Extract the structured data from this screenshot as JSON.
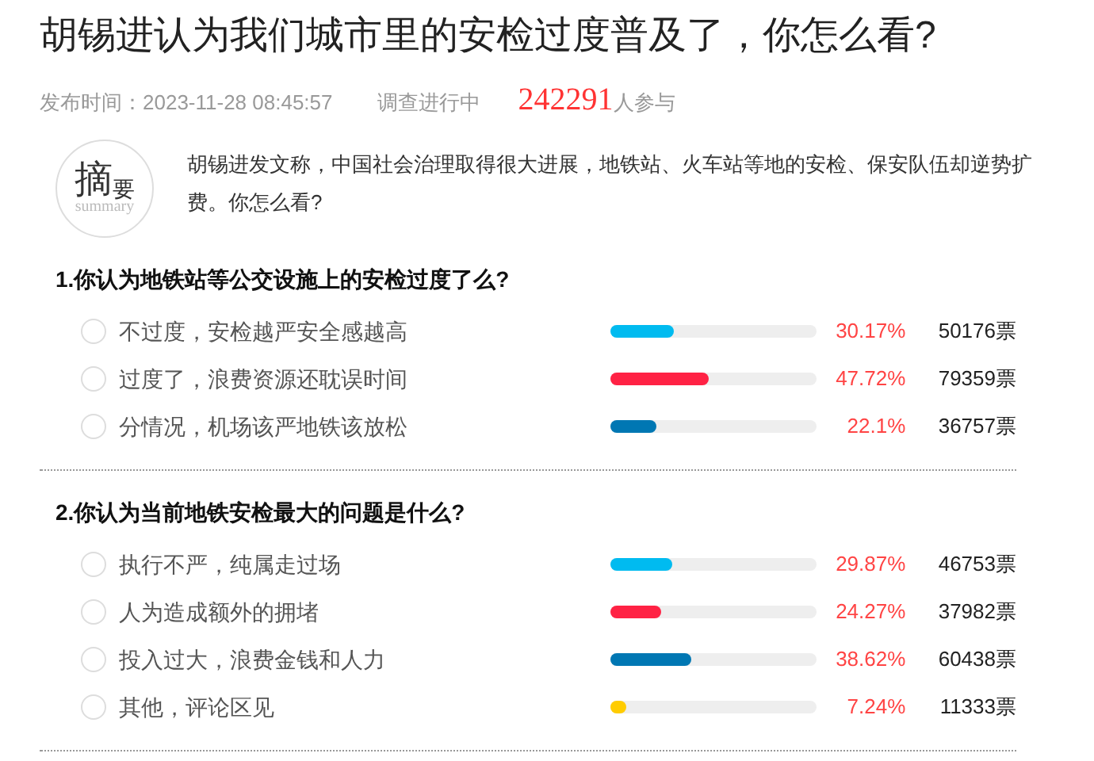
{
  "title": "胡锡进认为我们城市里的安检过度普及了，你怎么看?",
  "meta": {
    "published": "发布时间：2023-11-28 08:45:57",
    "status": "调查进行中",
    "participants": "242291",
    "participants_suffix": "人参与"
  },
  "summary": {
    "badge_main": "摘",
    "badge_sub": "要",
    "badge_word": "summary",
    "lines": [
      "胡锡进发文称，中国社会治理取得很大进展，地铁站、火车站等地的安检、保安队伍却逆势扩",
      "费。你怎么看?"
    ]
  },
  "questions": [
    {
      "title": "1.你认为地铁站等公交设施上的安检过度了么?",
      "options": [
        {
          "label": "不过度，安检越严安全感越高",
          "selected": false,
          "level": 0.3017,
          "color": "#00bbf0",
          "percent": "30.17%",
          "votes": "50176票"
        },
        {
          "label": "过度了，浪费资源还耽误时间",
          "selected": false,
          "level": 0.4772,
          "color": "#ff2244",
          "percent": "47.72%",
          "votes": "79359票"
        },
        {
          "label": "分情况，机场该严地铁该放松",
          "selected": false,
          "level": 0.221,
          "color": "#0077b3",
          "percent": "22.1%",
          "votes": "36757票"
        }
      ]
    },
    {
      "title": "2.你认为当前地铁安检最大的问题是什么?",
      "options": [
        {
          "label": "执行不严，纯属走过场",
          "selected": false,
          "level": 0.2987,
          "color": "#00bbf0",
          "percent": "29.87%",
          "votes": "46753票"
        },
        {
          "label": "人为造成额外的拥堵",
          "selected": false,
          "level": 0.2427,
          "color": "#ff2244",
          "percent": "24.27%",
          "votes": "37982票"
        },
        {
          "label": "投入过大，浪费金钱和人力",
          "selected": false,
          "level": 0.3862,
          "color": "#0077b3",
          "percent": "38.62%",
          "votes": "60438票"
        },
        {
          "label": "其他，评论区见",
          "selected": false,
          "level": 0.0724,
          "color": "#ffcc00",
          "percent": "7.24%",
          "votes": "11333票"
        }
      ]
    }
  ]
}
